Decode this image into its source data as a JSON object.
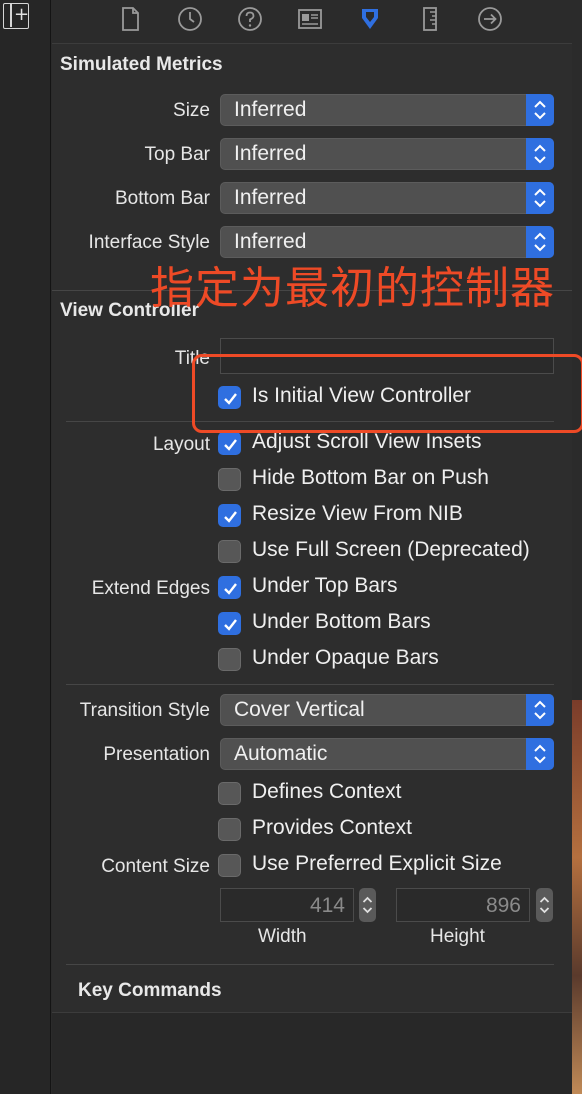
{
  "toolbar": {
    "tabs": [
      {
        "icon": "file-icon"
      },
      {
        "icon": "clock-icon"
      },
      {
        "icon": "help-icon"
      },
      {
        "icon": "identity-icon"
      },
      {
        "icon": "attributes-icon",
        "selected": true
      },
      {
        "icon": "ruler-icon"
      },
      {
        "icon": "connections-icon"
      }
    ]
  },
  "simulated_metrics": {
    "title": "Simulated Metrics",
    "size_label": "Size",
    "size_value": "Inferred",
    "topbar_label": "Top Bar",
    "topbar_value": "Inferred",
    "bottombar_label": "Bottom Bar",
    "bottombar_value": "Inferred",
    "interface_label": "Interface Style",
    "interface_value": "Inferred"
  },
  "annotation": {
    "text": "指定为最初的控制器",
    "color": "#ee4a26"
  },
  "view_controller": {
    "title": "View Controller",
    "title_label": "Title",
    "title_value": "",
    "initial_label": "Is Initial View Controller",
    "initial_checked": true,
    "layout_label": "Layout",
    "adjust_scroll": "Adjust Scroll View Insets",
    "adjust_scroll_checked": true,
    "hide_bottom_bar": "Hide Bottom Bar on Push",
    "hide_bottom_bar_checked": false,
    "resize_nib": "Resize View From NIB",
    "resize_nib_checked": true,
    "full_screen": "Use Full Screen (Deprecated)",
    "full_screen_checked": false,
    "extend_label": "Extend Edges",
    "under_top": "Under Top Bars",
    "under_top_checked": true,
    "under_bottom": "Under Bottom Bars",
    "under_bottom_checked": true,
    "under_opaque": "Under Opaque Bars",
    "under_opaque_checked": false,
    "transition_label": "Transition Style",
    "transition_value": "Cover Vertical",
    "presentation_label": "Presentation",
    "presentation_value": "Automatic",
    "defines_context": "Defines Context",
    "defines_context_checked": false,
    "provides_context": "Provides Context",
    "provides_context_checked": false,
    "content_size_label": "Content Size",
    "preferred_size": "Use Preferred Explicit Size",
    "preferred_size_checked": false,
    "width_value": "414",
    "height_value": "896",
    "width_caption": "Width",
    "height_caption": "Height"
  },
  "key_commands": {
    "title": "Key Commands"
  },
  "colors": {
    "accent": "#2f6fe0",
    "panel_bg": "#2d2d2d"
  }
}
